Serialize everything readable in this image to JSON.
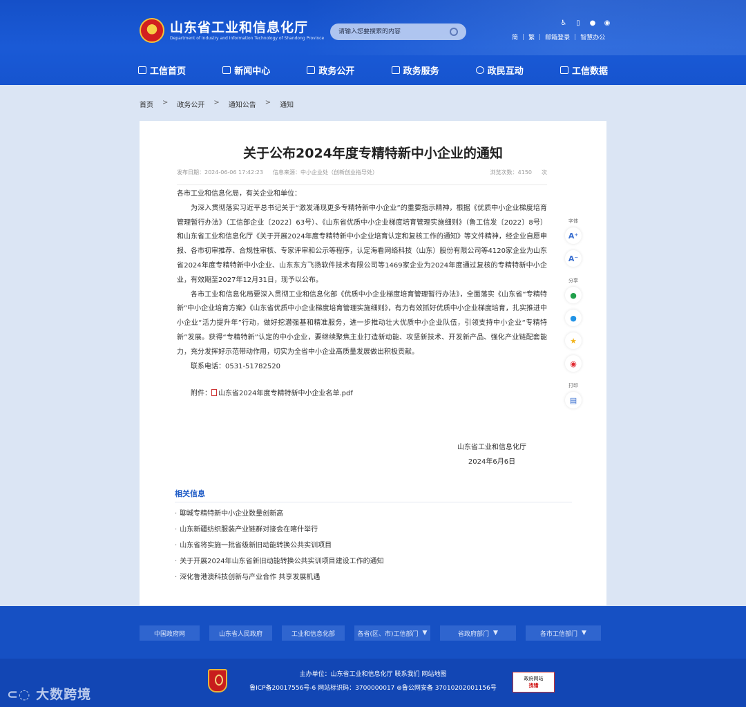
{
  "header": {
    "title_cn": "山东省工业和信息化厅",
    "title_en": "Department of Industry and Information Technology of Shandong Province",
    "search_placeholder": "请输入您要搜索的内容",
    "top_icons": [
      "accessibility-icon",
      "mobile-icon",
      "wechat-icon",
      "weibo-icon"
    ],
    "top_links": [
      "简",
      "繁",
      "邮箱登录",
      "智慧办公"
    ]
  },
  "nav": [
    "工信首页",
    "新闻中心",
    "政务公开",
    "政务服务",
    "政民互动",
    "工信数据"
  ],
  "breadcrumb": [
    "首页",
    "政务公开",
    "通知公告",
    "通知"
  ],
  "article": {
    "title": "关于公布2024年度专精特新中小企业的通知",
    "date_label": "发布日期：2024-06-06 17:42:23",
    "source_label": "信息来源：中小企业处（创新创业指导处）",
    "views_label": "浏览次数：4150",
    "views_unit": "次",
    "salutation": "各市工业和信息化局，有关企业和单位：",
    "para1": "为深入贯彻落实习近平总书记关于“激发涌现更多专精特新中小企业”的重要指示精神，根据《优质中小企业梯度培育管理暂行办法》（工信部企业〔2022〕63号）、《山东省优质中小企业梯度培育管理实施细则》（鲁工信发〔2022〕8号）和山东省工业和信息化厅《关于开展2024年度专精特新中小企业培育认定和复核工作的通知》等文件精神，经企业自愿申报、各市初审推荐、合规性审核、专家评审和公示等程序，认定海看网络科技（山东）股份有限公司等4120家企业为山东省2024年度专精特新中小企业、山东东方飞扬软件技术有限公司等1469家企业为2024年度通过复核的专精特新中小企业，有效期至2027年12月31日，现予以公布。",
    "para2": "各市工业和信息化局要深入贯彻工业和信息化部《优质中小企业梯度培育管理暂行办法》，全面落实《山东省“专精特新”中小企业培育方案》《山东省优质中小企业梯度培育管理实施细则》，有力有效抓好优质中小企业梯度培育，扎实推进中小企业“活力提升年”行动，做好挖潜强基和精准服务，进一步推动壮大优质中小企业队伍，引领支持中小企业“专精特新”发展。获得“专精特新”认定的中小企业，要继续聚焦主业打造新动能、攻坚新技术、开发新产品、强化产业链配套能力，充分发挥好示范带动作用，切实为全省中小企业高质量发展做出积极贡献。",
    "contact": "联系电话：0531-51782520",
    "attachment_label": "附件：",
    "attachment_file": "山东省2024年度专精特新中小企业名单.pdf",
    "signer": "山东省工业和信息化厅",
    "sign_date": "2024年6月6日"
  },
  "tools": {
    "font_label": "字体",
    "font_up": "A⁺",
    "font_down": "A⁻",
    "share_label": "分享",
    "print_label": "打印"
  },
  "related": {
    "title": "相关信息",
    "items": [
      "聊城专精特新中小企业数量创新高",
      "山东新疆纺织服装产业链群对接会在喀什举行",
      "山东省将实施一批省级新旧动能转换公共实训项目",
      "关于开展2024年山东省新旧动能转换公共实训项目建设工作的通知",
      "深化鲁港澳科技创新与产业合作 共享发展机遇"
    ]
  },
  "footer": {
    "links": [
      {
        "label": "中国政府网",
        "dropdown": false
      },
      {
        "label": "山东省人民政府",
        "dropdown": false
      },
      {
        "label": "工业和信息化部",
        "dropdown": false
      },
      {
        "label": "各省(区、市)工信部门",
        "dropdown": true
      },
      {
        "label": "省政府部门",
        "dropdown": true
      },
      {
        "label": "各市工信部门",
        "dropdown": true
      }
    ],
    "host": "主办单位：山东省工业和信息化厅 联系我们 网站地图",
    "icp": "鲁ICP备20017556号-6 网站标识码：3700000017",
    "police": "鲁公网安备 37010202001156号",
    "gov_badge_top": "政府网站",
    "gov_badge_bottom": "找错"
  },
  "watermark": "大数跨境"
}
